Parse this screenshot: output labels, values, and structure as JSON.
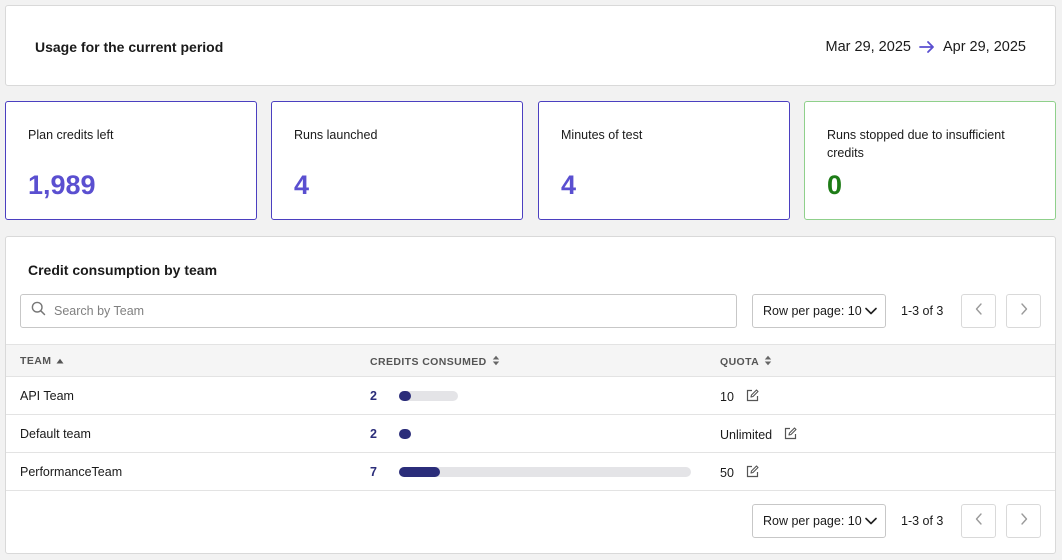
{
  "header": {
    "title": "Usage for the current period",
    "date_start": "Mar 29, 2025",
    "date_end": "Apr 29, 2025",
    "arrow_color": "#5a4fd0"
  },
  "stats": [
    {
      "label": "Plan credits left",
      "value": "1,989",
      "color": "#5a4fd0"
    },
    {
      "label": "Runs launched",
      "value": "4",
      "color": "#5a4fd0"
    },
    {
      "label": "Minutes of test",
      "value": "4",
      "color": "#5a4fd0"
    },
    {
      "label": "Runs stopped due to insufficient credits",
      "value": "0",
      "color": "#1e7c17"
    }
  ],
  "team_table": {
    "title": "Credit consumption by team",
    "search_placeholder": "Search by Team",
    "rows_per_page_label": "Row per page: 10",
    "range_label": "1-3 of 3",
    "columns": [
      "TEAM",
      "CREDITS CONSUMED",
      "QUOTA"
    ],
    "rows": [
      {
        "team": "API Team",
        "credits": "2",
        "quota": "10",
        "usage_fraction": 0.2
      },
      {
        "team": "Default team",
        "credits": "2",
        "quota": "Unlimited",
        "usage_fraction": 0
      },
      {
        "team": "PerformanceTeam",
        "credits": "7",
        "quota": "50",
        "usage_fraction": 0.14
      }
    ],
    "bar_color": "#2b2d7a"
  },
  "icons": {
    "date_arrow": "arrow-right-icon",
    "search": "search-icon",
    "dropdown": "chevron-down-icon",
    "prev": "chevron-left-icon",
    "next": "chevron-right-icon",
    "sort_asc": "sort-ascending-icon",
    "sort_both": "sort-icon",
    "edit": "edit-icon"
  }
}
